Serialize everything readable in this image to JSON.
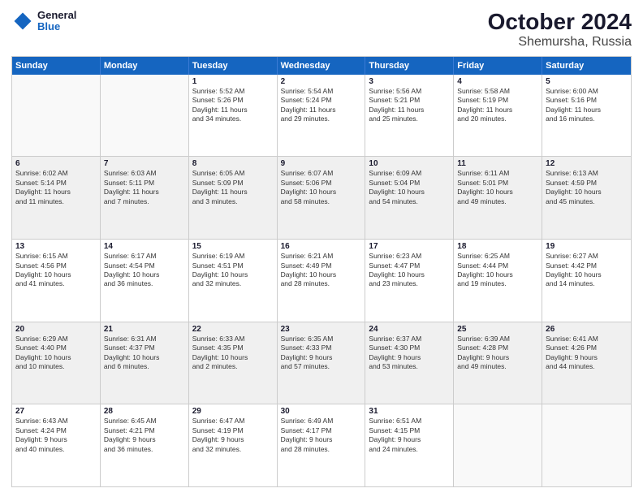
{
  "logo": {
    "general": "General",
    "blue": "Blue"
  },
  "title": "October 2024",
  "subtitle": "Shemursha, Russia",
  "days_of_week": [
    "Sunday",
    "Monday",
    "Tuesday",
    "Wednesday",
    "Thursday",
    "Friday",
    "Saturday"
  ],
  "weeks": [
    [
      {
        "day": "",
        "lines": [],
        "empty": true
      },
      {
        "day": "",
        "lines": [],
        "empty": true
      },
      {
        "day": "1",
        "lines": [
          "Sunrise: 5:52 AM",
          "Sunset: 5:26 PM",
          "Daylight: 11 hours",
          "and 34 minutes."
        ]
      },
      {
        "day": "2",
        "lines": [
          "Sunrise: 5:54 AM",
          "Sunset: 5:24 PM",
          "Daylight: 11 hours",
          "and 29 minutes."
        ]
      },
      {
        "day": "3",
        "lines": [
          "Sunrise: 5:56 AM",
          "Sunset: 5:21 PM",
          "Daylight: 11 hours",
          "and 25 minutes."
        ]
      },
      {
        "day": "4",
        "lines": [
          "Sunrise: 5:58 AM",
          "Sunset: 5:19 PM",
          "Daylight: 11 hours",
          "and 20 minutes."
        ]
      },
      {
        "day": "5",
        "lines": [
          "Sunrise: 6:00 AM",
          "Sunset: 5:16 PM",
          "Daylight: 11 hours",
          "and 16 minutes."
        ]
      }
    ],
    [
      {
        "day": "6",
        "lines": [
          "Sunrise: 6:02 AM",
          "Sunset: 5:14 PM",
          "Daylight: 11 hours",
          "and 11 minutes."
        ],
        "shaded": true
      },
      {
        "day": "7",
        "lines": [
          "Sunrise: 6:03 AM",
          "Sunset: 5:11 PM",
          "Daylight: 11 hours",
          "and 7 minutes."
        ],
        "shaded": true
      },
      {
        "day": "8",
        "lines": [
          "Sunrise: 6:05 AM",
          "Sunset: 5:09 PM",
          "Daylight: 11 hours",
          "and 3 minutes."
        ],
        "shaded": true
      },
      {
        "day": "9",
        "lines": [
          "Sunrise: 6:07 AM",
          "Sunset: 5:06 PM",
          "Daylight: 10 hours",
          "and 58 minutes."
        ],
        "shaded": true
      },
      {
        "day": "10",
        "lines": [
          "Sunrise: 6:09 AM",
          "Sunset: 5:04 PM",
          "Daylight: 10 hours",
          "and 54 minutes."
        ],
        "shaded": true
      },
      {
        "day": "11",
        "lines": [
          "Sunrise: 6:11 AM",
          "Sunset: 5:01 PM",
          "Daylight: 10 hours",
          "and 49 minutes."
        ],
        "shaded": true
      },
      {
        "day": "12",
        "lines": [
          "Sunrise: 6:13 AM",
          "Sunset: 4:59 PM",
          "Daylight: 10 hours",
          "and 45 minutes."
        ],
        "shaded": true
      }
    ],
    [
      {
        "day": "13",
        "lines": [
          "Sunrise: 6:15 AM",
          "Sunset: 4:56 PM",
          "Daylight: 10 hours",
          "and 41 minutes."
        ]
      },
      {
        "day": "14",
        "lines": [
          "Sunrise: 6:17 AM",
          "Sunset: 4:54 PM",
          "Daylight: 10 hours",
          "and 36 minutes."
        ]
      },
      {
        "day": "15",
        "lines": [
          "Sunrise: 6:19 AM",
          "Sunset: 4:51 PM",
          "Daylight: 10 hours",
          "and 32 minutes."
        ]
      },
      {
        "day": "16",
        "lines": [
          "Sunrise: 6:21 AM",
          "Sunset: 4:49 PM",
          "Daylight: 10 hours",
          "and 28 minutes."
        ]
      },
      {
        "day": "17",
        "lines": [
          "Sunrise: 6:23 AM",
          "Sunset: 4:47 PM",
          "Daylight: 10 hours",
          "and 23 minutes."
        ]
      },
      {
        "day": "18",
        "lines": [
          "Sunrise: 6:25 AM",
          "Sunset: 4:44 PM",
          "Daylight: 10 hours",
          "and 19 minutes."
        ]
      },
      {
        "day": "19",
        "lines": [
          "Sunrise: 6:27 AM",
          "Sunset: 4:42 PM",
          "Daylight: 10 hours",
          "and 14 minutes."
        ]
      }
    ],
    [
      {
        "day": "20",
        "lines": [
          "Sunrise: 6:29 AM",
          "Sunset: 4:40 PM",
          "Daylight: 10 hours",
          "and 10 minutes."
        ],
        "shaded": true
      },
      {
        "day": "21",
        "lines": [
          "Sunrise: 6:31 AM",
          "Sunset: 4:37 PM",
          "Daylight: 10 hours",
          "and 6 minutes."
        ],
        "shaded": true
      },
      {
        "day": "22",
        "lines": [
          "Sunrise: 6:33 AM",
          "Sunset: 4:35 PM",
          "Daylight: 10 hours",
          "and 2 minutes."
        ],
        "shaded": true
      },
      {
        "day": "23",
        "lines": [
          "Sunrise: 6:35 AM",
          "Sunset: 4:33 PM",
          "Daylight: 9 hours",
          "and 57 minutes."
        ],
        "shaded": true
      },
      {
        "day": "24",
        "lines": [
          "Sunrise: 6:37 AM",
          "Sunset: 4:30 PM",
          "Daylight: 9 hours",
          "and 53 minutes."
        ],
        "shaded": true
      },
      {
        "day": "25",
        "lines": [
          "Sunrise: 6:39 AM",
          "Sunset: 4:28 PM",
          "Daylight: 9 hours",
          "and 49 minutes."
        ],
        "shaded": true
      },
      {
        "day": "26",
        "lines": [
          "Sunrise: 6:41 AM",
          "Sunset: 4:26 PM",
          "Daylight: 9 hours",
          "and 44 minutes."
        ],
        "shaded": true
      }
    ],
    [
      {
        "day": "27",
        "lines": [
          "Sunrise: 6:43 AM",
          "Sunset: 4:24 PM",
          "Daylight: 9 hours",
          "and 40 minutes."
        ]
      },
      {
        "day": "28",
        "lines": [
          "Sunrise: 6:45 AM",
          "Sunset: 4:21 PM",
          "Daylight: 9 hours",
          "and 36 minutes."
        ]
      },
      {
        "day": "29",
        "lines": [
          "Sunrise: 6:47 AM",
          "Sunset: 4:19 PM",
          "Daylight: 9 hours",
          "and 32 minutes."
        ]
      },
      {
        "day": "30",
        "lines": [
          "Sunrise: 6:49 AM",
          "Sunset: 4:17 PM",
          "Daylight: 9 hours",
          "and 28 minutes."
        ]
      },
      {
        "day": "31",
        "lines": [
          "Sunrise: 6:51 AM",
          "Sunset: 4:15 PM",
          "Daylight: 9 hours",
          "and 24 minutes."
        ]
      },
      {
        "day": "",
        "lines": [],
        "empty": true
      },
      {
        "day": "",
        "lines": [],
        "empty": true
      }
    ]
  ]
}
